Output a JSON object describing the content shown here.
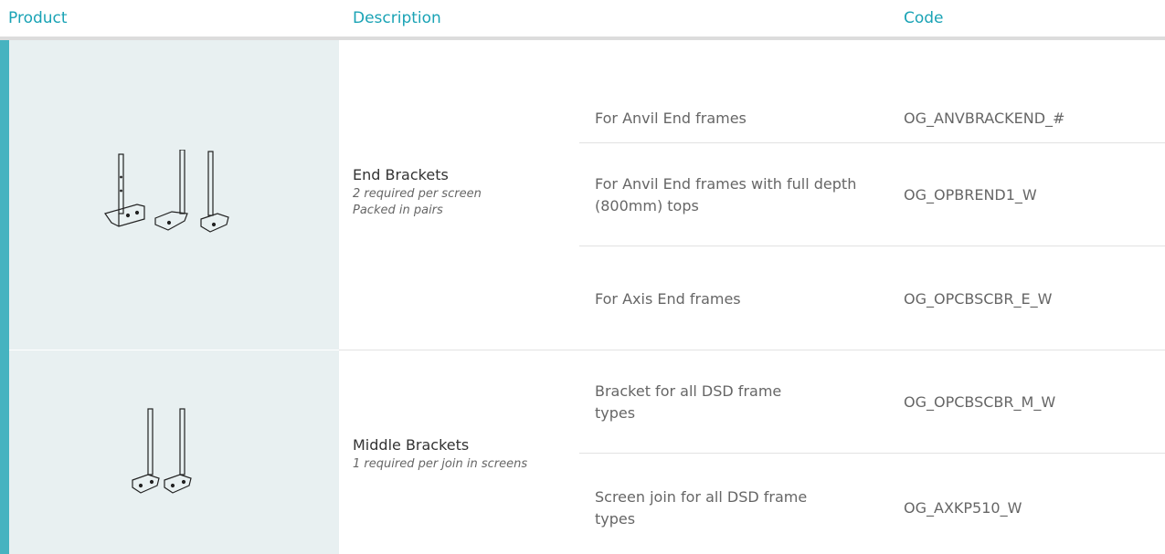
{
  "headers": {
    "product": "Product",
    "description": "Description",
    "code": "Code"
  },
  "groups": [
    {
      "name": "End Brackets",
      "notes": [
        "2 required per screen",
        "Packed in pairs"
      ],
      "image_icon": "end-brackets-icon",
      "rows": [
        {
          "detail": "For Anvil End frames",
          "code": "OG_ANVBRACKEND_#"
        },
        {
          "detail": "For Anvil End frames with full depth (800mm) tops",
          "code": "OG_OPBREND1_W"
        },
        {
          "detail": "For Axis End frames",
          "code": "OG_OPCBSCBR_E_W"
        }
      ]
    },
    {
      "name": "Middle Brackets",
      "notes": [
        "1 required per join in screens"
      ],
      "image_icon": "middle-brackets-icon",
      "rows": [
        {
          "detail": "Bracket for all DSD frame types",
          "code": "OG_OPCBSCBR_M_W"
        },
        {
          "detail": "Screen join for all DSD frame types",
          "code": "OG_AXKP510_W"
        }
      ]
    }
  ],
  "colors": {
    "accent": "#46b3c0",
    "header_text": "#1aa3b5",
    "image_bg": "#e8f0f1"
  }
}
